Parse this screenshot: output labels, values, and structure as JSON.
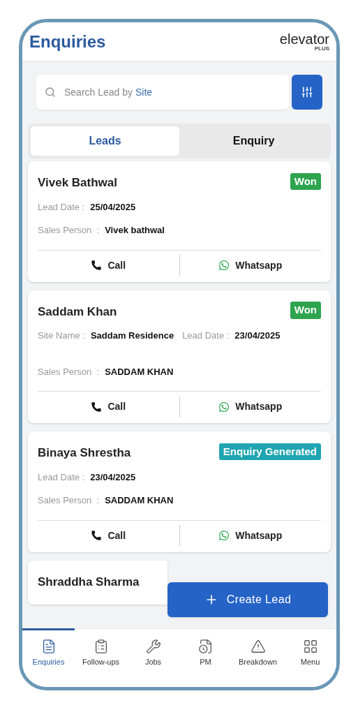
{
  "header": {
    "title": "Enquiries",
    "logo": "elevator",
    "logo_sub": "PLUS"
  },
  "search": {
    "placeholder_parts": [
      "Search Lead by ",
      "Site"
    ]
  },
  "tabs": [
    {
      "label": "Leads",
      "selected": true
    },
    {
      "label": "Enquiry",
      "selected": false
    }
  ],
  "leads": [
    {
      "name": "Vivek Bathwal",
      "status": "Won",
      "color": "#2ea44f",
      "rows": [
        [
          {
            "label": "Lead Date :",
            "value": "25/04/2025"
          }
        ],
        [
          {
            "label": "Sales Person  :",
            "value": "Vivek bathwal"
          }
        ]
      ],
      "actions": [
        "Call",
        "Whatsapp"
      ]
    },
    {
      "name": "Saddam Khan",
      "status": "Won",
      "color": "#2ea44f",
      "rows": [
        [
          {
            "label": "Site Name :",
            "value": "Saddam Residence"
          },
          {
            "label": "Lead Date :",
            "value": "23/04/2025"
          }
        ],
        [
          {
            "label": "Sales Person  :",
            "value": "SADDAM KHAN"
          }
        ]
      ],
      "actions": [
        "Call",
        "Whatsapp"
      ]
    },
    {
      "name": "Binaya Shrestha",
      "status": "Enquiry Generated",
      "color": "#1fa5b0",
      "rows": [
        [
          {
            "label": "Lead Date :",
            "value": "23/04/2025"
          }
        ],
        [
          {
            "label": "Sales Person  :",
            "value": "SADDAM KHAN"
          }
        ]
      ],
      "actions": [
        "Call",
        "Whatsapp"
      ]
    },
    {
      "name": "Shraddha Sharma"
    }
  ],
  "fab": {
    "label": "Create Lead"
  },
  "nav": [
    {
      "label": "Enquiries",
      "selected": true
    },
    {
      "label": "Follow-ups",
      "selected": false
    },
    {
      "label": "Jobs",
      "selected": false
    },
    {
      "label": "PM",
      "selected": false
    },
    {
      "label": "Breakdown",
      "selected": false
    },
    {
      "label": "Menu",
      "selected": false
    }
  ]
}
